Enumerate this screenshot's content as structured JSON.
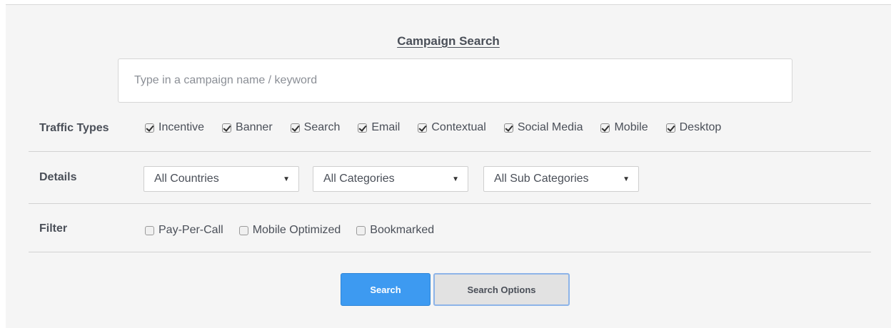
{
  "title": "Campaign Search",
  "search": {
    "placeholder": "Type in a campaign name / keyword",
    "value": ""
  },
  "traffic_types": {
    "label": "Traffic Types",
    "options": [
      {
        "label": "Incentive",
        "checked": true
      },
      {
        "label": "Banner",
        "checked": true
      },
      {
        "label": "Search",
        "checked": true
      },
      {
        "label": "Email",
        "checked": true
      },
      {
        "label": "Contextual",
        "checked": true
      },
      {
        "label": "Social Media",
        "checked": true
      },
      {
        "label": "Mobile",
        "checked": true
      },
      {
        "label": "Desktop",
        "checked": true
      }
    ]
  },
  "details": {
    "label": "Details",
    "selects": [
      {
        "value": "All Countries"
      },
      {
        "value": "All Categories"
      },
      {
        "value": "All Sub Categories"
      }
    ]
  },
  "filter": {
    "label": "Filter",
    "options": [
      {
        "label": "Pay-Per-Call",
        "checked": false
      },
      {
        "label": "Mobile Optimized",
        "checked": false
      },
      {
        "label": "Bookmarked",
        "checked": false
      }
    ]
  },
  "buttons": {
    "search": "Search",
    "search_options": "Search Options"
  },
  "colors": {
    "primary": "#3d9af1",
    "panel_background": "#f5f5f5",
    "text": "#4a4f58"
  },
  "icons": {
    "dropdown": "chevron-down-icon",
    "checkbox_checked": "checkbox-checked-icon",
    "checkbox_unchecked": "checkbox-unchecked-icon"
  }
}
